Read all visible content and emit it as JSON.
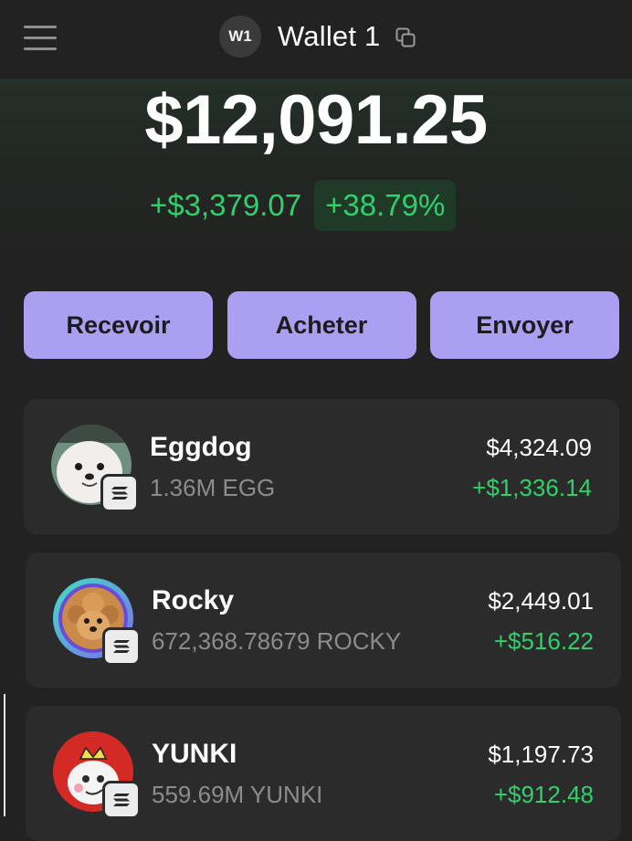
{
  "header": {
    "avatar_label": "W1",
    "wallet_name": "Wallet 1",
    "menu_icon": "hamburger-menu-icon",
    "copy_icon": "copy-icon"
  },
  "portfolio": {
    "balance": "$12,091.25",
    "change_amount": "+$3,379.07",
    "change_percent": "+38.79%"
  },
  "actions": {
    "receive": "Recevoir",
    "buy": "Acheter",
    "send": "Envoyer"
  },
  "tokens": [
    {
      "name": "Eggdog",
      "amount": "1.36M EGG",
      "value": "$4,324.09",
      "change": "+$1,336.14",
      "chain_icon": "solana-icon"
    },
    {
      "name": "Rocky",
      "amount": "672,368.78679 ROCKY",
      "value": "$2,449.01",
      "change": "+$516.22",
      "chain_icon": "solana-icon"
    },
    {
      "name": "YUNKI",
      "amount": "559.69M YUNKI",
      "value": "$1,197.73",
      "change": "+$912.48",
      "chain_icon": "solana-icon"
    }
  ],
  "colors": {
    "background": "#222222",
    "accent": "#ab9ff2",
    "positive": "#2fd16a",
    "card": "#2b2b2b"
  }
}
